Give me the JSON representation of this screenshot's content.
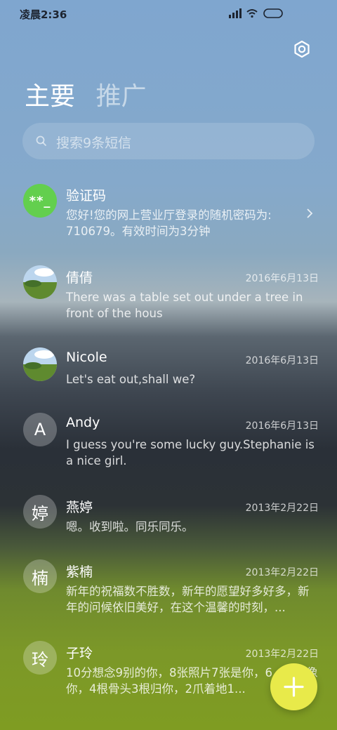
{
  "status_bar": {
    "time": "凌晨2:36"
  },
  "tabs": {
    "primary": "主要",
    "promotions": "推广"
  },
  "search": {
    "placeholder": "搜索9条短信"
  },
  "messages": [
    {
      "sender": "验证码",
      "avatar_text": "**_",
      "date": "",
      "preview": "您好!您的网上营业厅登录的随机密码为: 710679。有效时间为3分钟"
    },
    {
      "sender": "倩倩",
      "avatar_text": "",
      "date": "2016年6月13日",
      "preview": "There was a table set out under a tree in front of the hous"
    },
    {
      "sender": "Nicole",
      "avatar_text": "",
      "date": "2016年6月13日",
      "preview": "Let's eat out,shall we?"
    },
    {
      "sender": "Andy",
      "avatar_text": "A",
      "date": "2016年6月13日",
      "preview": "I guess you're some lucky guy.Stephanie is a nice girl."
    },
    {
      "sender": "燕婷",
      "avatar_text": "婷",
      "date": "2013年2月22日",
      "preview": "嗯。收到啦。同乐同乐。"
    },
    {
      "sender": "紫楠",
      "avatar_text": "楠",
      "date": "2013年2月22日",
      "preview": "新年的祝福数不胜数，新年的愿望好多好多，新年的问候依旧美好，在这个温馨的时刻，..."
    },
    {
      "sender": "子玲",
      "avatar_text": "玲",
      "date": "2013年2月22日",
      "preview": "10分想念9别的你，8张照片7张是你，6... 5只像你，4根骨头3根归你，2爪着地1..."
    }
  ],
  "colors": {
    "fab": "#e8ea4a",
    "code_avatar": "#63cf4e"
  },
  "icons": {
    "settings": "gear-icon",
    "search": "search-icon",
    "compose": "plus-icon",
    "open": "chevron-right-icon"
  }
}
